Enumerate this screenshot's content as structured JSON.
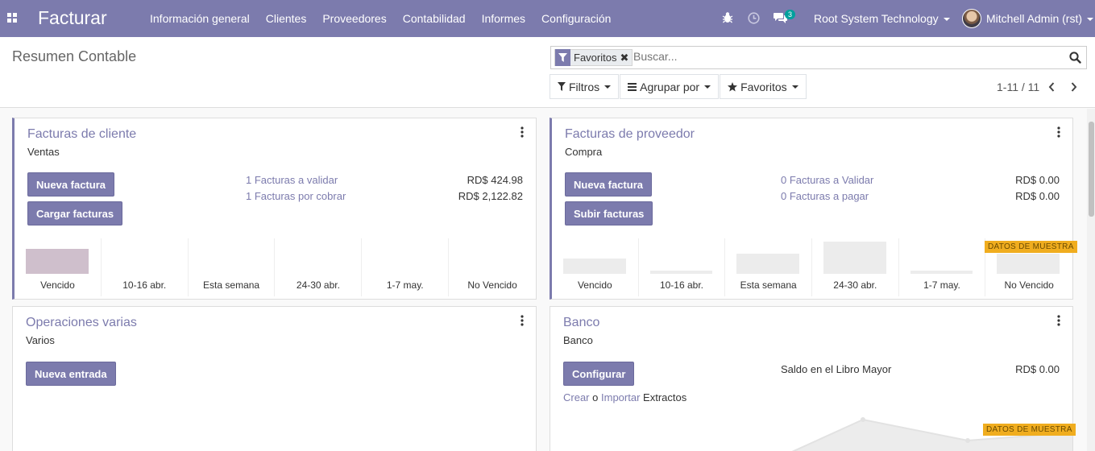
{
  "navbar": {
    "app_name": "Facturar",
    "menu": [
      "Información general",
      "Clientes",
      "Proveedores",
      "Contabilidad",
      "Informes",
      "Configuración"
    ],
    "message_count": "3",
    "company": "Root System Technology",
    "user": "Mitchell Admin (rst)"
  },
  "control_panel": {
    "title": "Resumen Contable",
    "facet_label": "Favoritos",
    "search_placeholder": "Buscar...",
    "filters_label": "Filtros",
    "groupby_label": "Agrupar por",
    "favorites_label": "Favoritos",
    "pager": "1-11 / 11"
  },
  "cards": {
    "customer_invoices": {
      "title": "Facturas de cliente",
      "subtitle": "Ventas",
      "btn_new": "Nueva factura",
      "btn_upload": "Cargar facturas",
      "stats": [
        {
          "label": "1 Facturas a validar",
          "amount": "RD$ 424.98"
        },
        {
          "label": "1 Facturas por cobrar",
          "amount": "RD$ 2,122.82"
        }
      ],
      "graph": [
        {
          "label": "Vencido",
          "value": 0.65
        },
        {
          "label": "10-16 abr.",
          "value": 0
        },
        {
          "label": "Esta semana",
          "value": 0
        },
        {
          "label": "24-30 abr.",
          "value": 0
        },
        {
          "label": "1-7 may.",
          "value": 0
        },
        {
          "label": "No Vencido",
          "value": 0
        }
      ]
    },
    "vendor_bills": {
      "title": "Facturas de proveedor",
      "subtitle": "Compra",
      "btn_new": "Nueva factura",
      "btn_upload": "Subir facturas",
      "sample_badge": "DATOS DE MUESTRA",
      "stats": [
        {
          "label": "0 Facturas a Validar",
          "amount": "RD$ 0.00"
        },
        {
          "label": "0 Facturas a pagar",
          "amount": "RD$ 0.00"
        }
      ],
      "graph": [
        {
          "label": "Vencido",
          "value": 0.45
        },
        {
          "label": "10-16 abr.",
          "value": 0.1
        },
        {
          "label": "Esta semana",
          "value": 0.6
        },
        {
          "label": "24-30 abr.",
          "value": 0.95
        },
        {
          "label": "1-7 may.",
          "value": 0.1
        },
        {
          "label": "No Vencido",
          "value": 0.6
        }
      ]
    },
    "misc": {
      "title": "Operaciones varias",
      "subtitle": "Varios",
      "btn_new": "Nueva entrada"
    },
    "bank": {
      "title": "Banco",
      "subtitle": "Banco",
      "btn_config": "Configurar",
      "balance_label": "Saldo en el Libro Mayor",
      "balance_amount": "RD$ 0.00",
      "create_link": "Crear",
      "or_text": "o",
      "import_link": "Importar",
      "statements_text": "Extractos",
      "sample_badge": "DATOS DE MUESTRA"
    }
  },
  "colors": {
    "brand": "#7c7bad",
    "badge": "#00a09d",
    "sample_badge": "#f0ad1f"
  }
}
